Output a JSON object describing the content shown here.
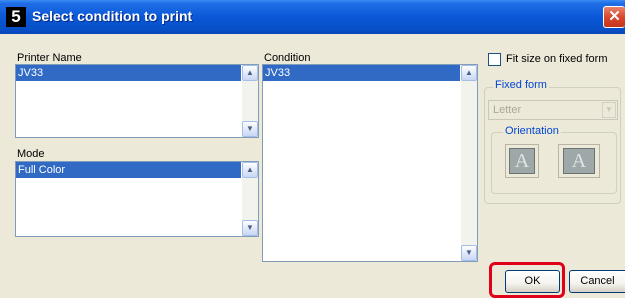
{
  "window": {
    "app_logo": "5",
    "title": "Select condition to print",
    "close_glyph": "✕"
  },
  "printer": {
    "label": "Printer Name",
    "selected": "JV33"
  },
  "mode": {
    "label": "Mode",
    "selected": "Full Color"
  },
  "condition": {
    "label": "Condition",
    "selected": "JV33"
  },
  "fit": {
    "label": "Fit size on fixed form",
    "checked": false
  },
  "fixed_form": {
    "label": "Fixed form",
    "value": "Letter",
    "enabled": false
  },
  "orientation": {
    "label": "Orientation",
    "options": [
      "portrait",
      "landscape"
    ]
  },
  "orientation_glyph": "A",
  "buttons": {
    "ok": "OK",
    "cancel": "Cancel"
  },
  "icons": {
    "scroll_up": "▲",
    "scroll_down": "▼",
    "dropdown": "▼"
  },
  "colors": {
    "title_bar": "#0a58d8",
    "selection": "#316ac5",
    "highlight": "#e0001a",
    "group_label": "#0046d5"
  }
}
